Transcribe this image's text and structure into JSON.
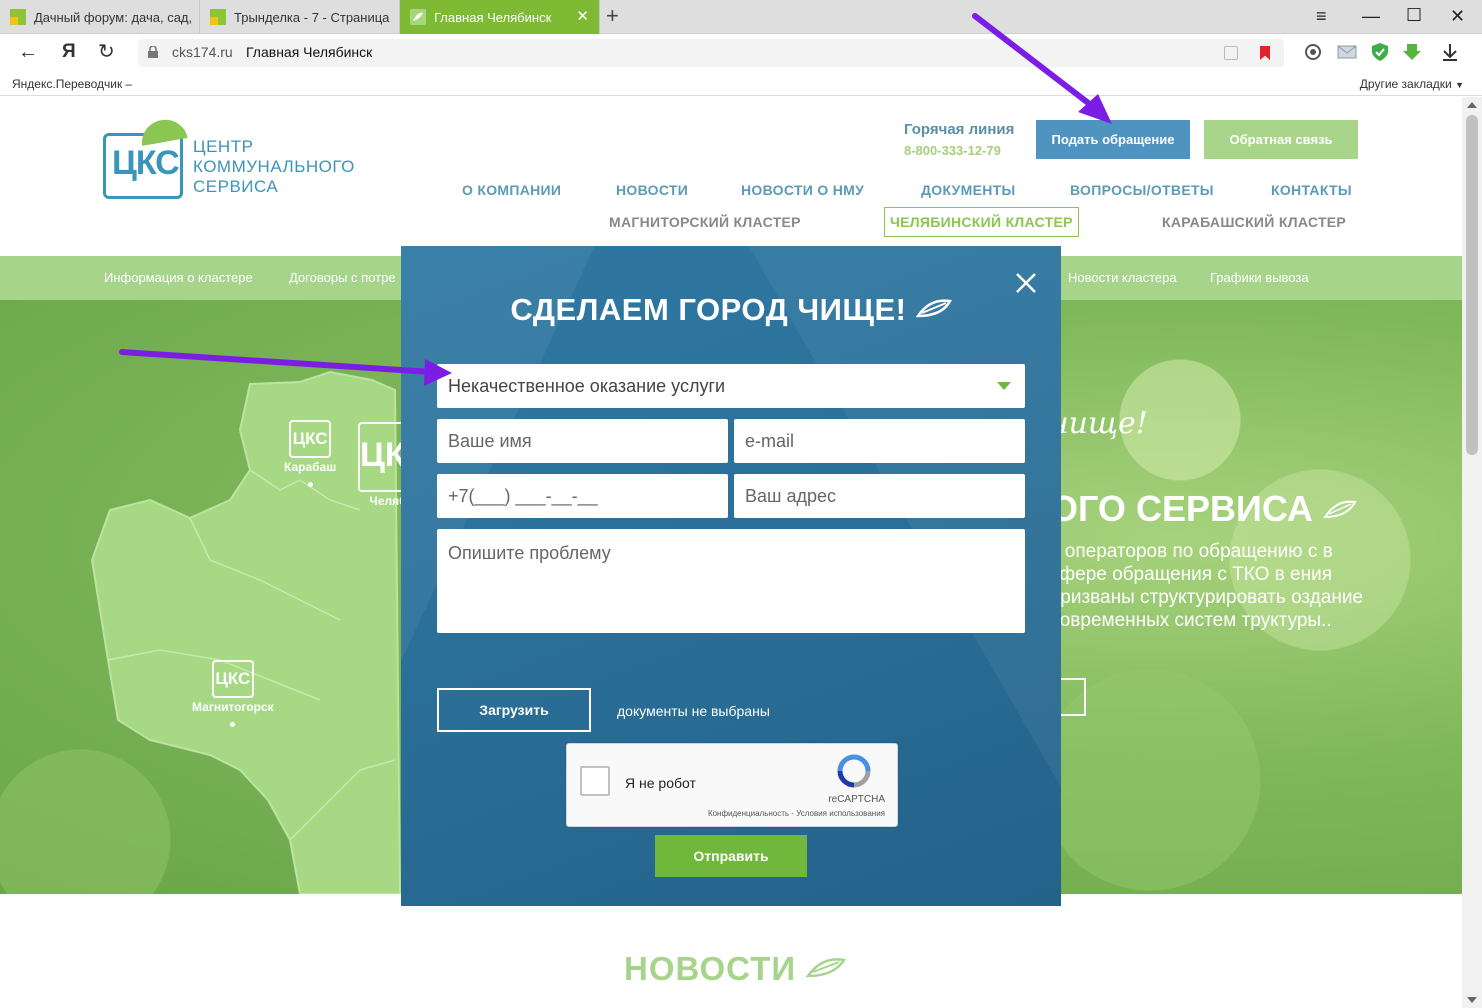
{
  "browser": {
    "tabs": [
      {
        "title": "Дачный форум: дача, сад,",
        "active": false
      },
      {
        "title": "Трынделка - 7 - Страница",
        "active": false
      },
      {
        "title": "Главная Челябинск",
        "active": true
      }
    ],
    "address": {
      "host": "cks174.ru",
      "title": "Главная Челябинск"
    },
    "bookmarks": {
      "left": "Яндекс.Переводчик – ",
      "right": "Другие закладки"
    },
    "yandex_label": "Я"
  },
  "header": {
    "logo_text": "ЦКС",
    "brand_lines": [
      "ЦЕНТР",
      "КОММУНАЛЬНОГО",
      "СЕРВИСА"
    ],
    "hotline_title": "Горячая линия",
    "hotline_phone": "8-800-333-12-79",
    "appeal_button": "Подать обращение",
    "feedback_button": "Обратная связь",
    "menu": [
      "О КОМПАНИИ",
      "НОВОСТИ",
      "НОВОСТИ О НМУ",
      "ДОКУМЕНТЫ",
      "ВОПРОСЫ/ОТВЕТЫ",
      "КОНТАКТЫ"
    ],
    "clusters": [
      "МАГНИТОРСКИЙ КЛАСТЕР",
      "ЧЕЛЯБИНСКИЙ КЛАСТЕР",
      "КАРАБАШСКИЙ КЛАСТЕР"
    ]
  },
  "subnav": {
    "items": [
      "Информация о кластере",
      "Договоры с потре",
      "Новости кластера",
      "Графики вывоза"
    ]
  },
  "hero": {
    "cities": [
      "Карабаш",
      "Челяб",
      "Магнитогорск"
    ],
    "city_logo": "ЦКС",
    "script": "чище!",
    "title": "ОГО СЕРВИСА",
    "desc": "х операторов по обращению с в сфере обращения с ТКО в ения призваны структурировать оздание современных систем труктуры.."
  },
  "news": {
    "title": "НОВОСТИ"
  },
  "modal": {
    "title": "СДЕЛАЕМ ГОРОД ЧИЩЕ!",
    "category_value": "Некачественное оказание услуги",
    "name_placeholder": "Ваше имя",
    "email_placeholder": "e-mail",
    "phone_placeholder": "+7(___) ___-__-__",
    "address_placeholder": "Ваш адрес",
    "problem_placeholder": "Опишите проблему",
    "upload_button": "Загрузить",
    "upload_status": "документы не выбраны",
    "captcha_label": "Я не робот",
    "captcha_brand": "reCAPTCHA",
    "captcha_links": "Конфиденциальность - Условия использования",
    "submit_button": "Отправить"
  },
  "colors": {
    "accent_green": "#8bc653",
    "accent_blue": "#4f94c0",
    "modal_bg": "#2a6f98",
    "annotation_arrow": "#7a1ee6"
  }
}
